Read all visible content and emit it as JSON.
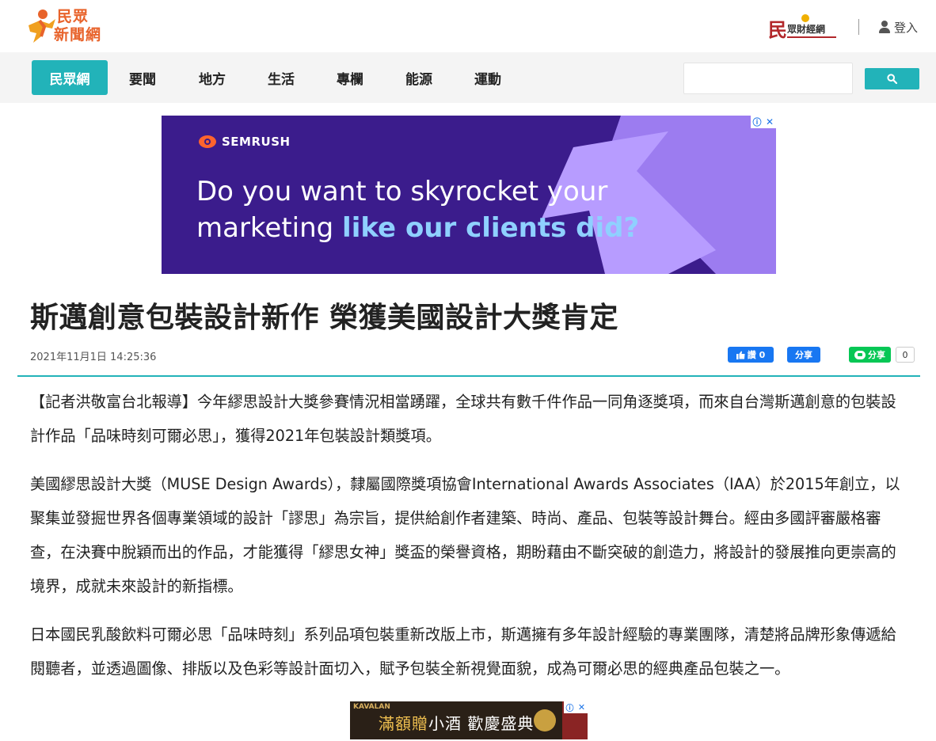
{
  "header": {
    "logo_line1": "民眾",
    "logo_line2": "新聞網",
    "finance_logo_main": "民",
    "finance_logo_sub": "眾財經網",
    "login_label": "登入",
    "icons": {
      "login": "user-icon",
      "logo": "running-figure-icon"
    }
  },
  "nav": {
    "home_label": "民眾網",
    "items": [
      {
        "label": "要聞"
      },
      {
        "label": "地方"
      },
      {
        "label": "生活"
      },
      {
        "label": "專欄"
      },
      {
        "label": "能源"
      },
      {
        "label": "運動"
      }
    ],
    "search_placeholder": "",
    "search_icon": "search-icon",
    "accent_color": "#22b3b9"
  },
  "ad_top": {
    "brand": "SEMRUSH",
    "line1": "Do you want to skyrocket your",
    "line2_plain": "marketing ",
    "line2_highlight": "like our clients did?",
    "info_icon": "ⓘ",
    "close_icon": "✕"
  },
  "article": {
    "title": "斯邁創意包裝設計新作 榮獲美國設計大獎肯定",
    "date": "2021年11月1日 14:25:36",
    "social": {
      "fb_like_label": "讚 0",
      "fb_share_label": "分享",
      "line_share_label": "分享",
      "line_count": "0"
    },
    "paragraphs": [
      "【記者洪敬富台北報導】今年繆思設計大獎參賽情況相當踴躍，全球共有數千件作品一同角逐獎項，而來自台灣斯邁創意的包裝設計作品「品味時刻可爾必思」，獲得2021年包裝設計類獎項。",
      "美國繆思設計大獎（MUSE Design Awards），隸屬國際獎項協會International Awards Associates（IAA）於2015年創立，以聚集並發掘世界各個專業領域的設計「謬思」為宗旨，提供給創作者建築、時尚、產品、包裝等設計舞台。經由多國評審嚴格審查，在決賽中脫穎而出的作品，才能獲得「繆思女神」獎盃的榮譽資格，期盼藉由不斷突破的創造力，將設計的發展推向更崇高的境界，成就未來設計的新指標。",
      "日本國民乳酸飲料可爾必思「品味時刻」系列品項包裝重新改版上市，斯邁擁有多年設計經驗的專業團隊，清楚將品牌形象傳遞給閱聽者，並透過圖像、排版以及色彩等設計面切入，賦予包裝全新視覺面貌，成為可爾必思的經典產品包裝之一。"
    ]
  },
  "ad_bottom": {
    "brand": "KAVALAN",
    "text_highlight": "滿額贈",
    "text_plain": "小酒 歡慶盛典",
    "info_icon": "ⓘ",
    "close_icon": "✕"
  }
}
